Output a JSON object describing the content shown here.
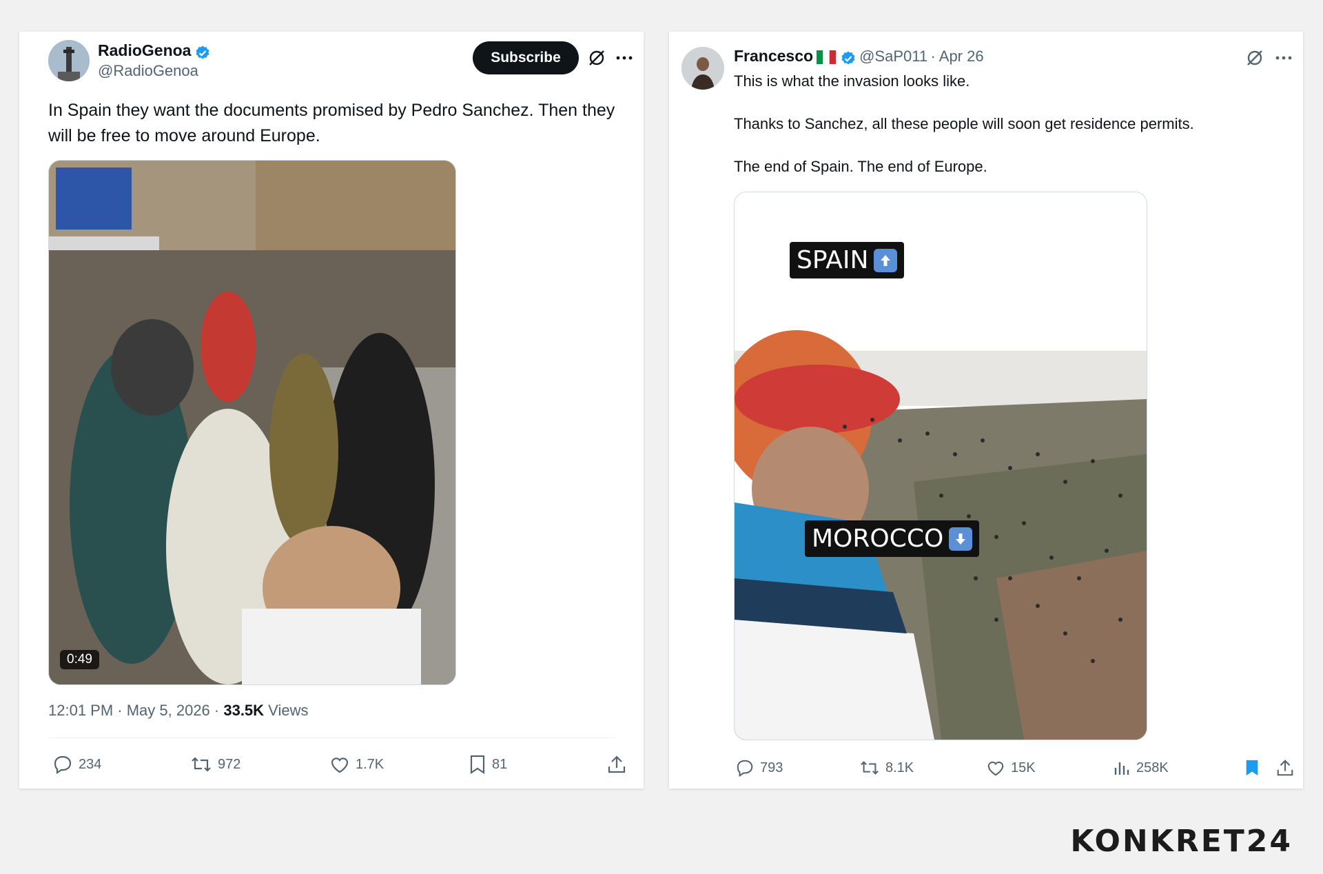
{
  "post1": {
    "display_name": "RadioGenoa",
    "handle": "@RadioGenoa",
    "subscribe_label": "Subscribe",
    "text": "In Spain they want the documents promised by Pedro Sanchez. Then they will be free to move around Europe.",
    "video_duration": "0:49",
    "timestamp": "12:01 PM · May 5, 2026 · ",
    "views_count": "33.5K",
    "views_label": " Views",
    "replies": "234",
    "reposts": "972",
    "likes": "1.7K",
    "bookmarks": "81"
  },
  "post2": {
    "display_name": "Francesco",
    "flag": "🇮🇹",
    "handle": "@SaP011",
    "date": "· Apr 26",
    "text_line1": "This is what the invasion looks like.",
    "text_line2": "Thanks to Sanchez, all these people will soon get residence permits.",
    "text_line3": "The end of Spain. The end of Europe.",
    "overlay_top": "SPAIN",
    "overlay_bottom": "MOROCCO",
    "replies": "793",
    "reposts": "8.1K",
    "likes": "15K",
    "views": "258K"
  },
  "watermark": "KONKRET24",
  "colors": {
    "verified_blue": "#1d9bf0",
    "bookmark_active": "#1d9bf0",
    "text_primary": "#0f1419",
    "text_secondary": "#536471"
  },
  "icons": [
    "verified-badge-icon",
    "grok-icon",
    "more-icon",
    "reply-icon",
    "repost-icon",
    "like-icon",
    "bookmark-icon",
    "share-icon",
    "views-icon"
  ]
}
